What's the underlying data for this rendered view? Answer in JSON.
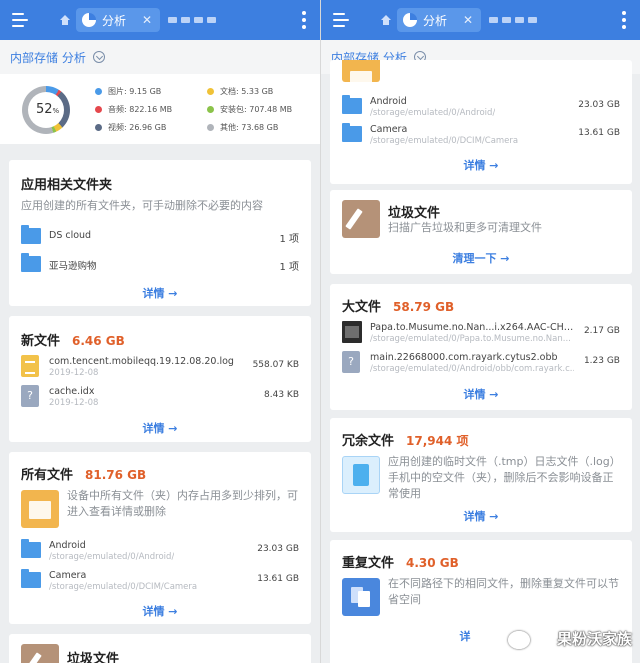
{
  "topbar": {
    "tab_label": "分析",
    "tab_close": "✕"
  },
  "subheader": {
    "title": "内部存储 分析"
  },
  "left": {
    "summary": {
      "percent": "52",
      "percent_unit": "%",
      "legend": [
        {
          "label": "图片: 9.15 GB",
          "color": "#4a9ae8"
        },
        {
          "label": "文档: 5.33 GB",
          "color": "#f0c237"
        },
        {
          "label": "音频: 822.16 MB",
          "color": "#e5484d"
        },
        {
          "label": "安装包: 707.48 MB",
          "color": "#8bc34a"
        },
        {
          "label": "视频: 26.96 GB",
          "color": "#5b6b86"
        },
        {
          "label": "其他: 73.68 GB",
          "color": "#b0b4ba"
        }
      ]
    },
    "app_folders": {
      "title": "应用相关文件夹",
      "desc": "应用创建的所有文件夹，可手动删除不必要的内容",
      "items": [
        {
          "name": "DS cloud",
          "count": "1 项"
        },
        {
          "name": "亚马逊购物",
          "count": "1 项"
        }
      ],
      "more": "详情 →"
    },
    "new_files": {
      "title": "新文件",
      "amount": "6.46 GB",
      "items": [
        {
          "name": "com.tencent.mobileqq.19.12.08.20.log",
          "date": "2019-12-08",
          "size": "558.07 KB"
        },
        {
          "name": "cache.idx",
          "date": "2019-12-08",
          "size": "8.43 KB"
        }
      ],
      "more": "详情 →"
    },
    "all_files": {
      "title": "所有文件",
      "amount": "81.76 GB",
      "desc": "设备中所有文件（夹）内存占用多到少排列，可进入查看详情或删除",
      "items": [
        {
          "name": "Android",
          "path": "/storage/emulated/0/Android/",
          "size": "23.03 GB"
        },
        {
          "name": "Camera",
          "path": "/storage/emulated/0/DCIM/Camera",
          "size": "13.61 GB"
        }
      ],
      "more": "详情 →"
    },
    "junk_peek": {
      "title": "垃圾文件"
    }
  },
  "right": {
    "all_files_tail": {
      "items": [
        {
          "name": "Android",
          "path": "/storage/emulated/0/Android/",
          "size": "23.03 GB"
        },
        {
          "name": "Camera",
          "path": "/storage/emulated/0/DCIM/Camera",
          "size": "13.61 GB"
        }
      ],
      "more": "详情 →"
    },
    "junk": {
      "title": "垃圾文件",
      "desc": "扫描广告垃圾和更多可清理文件",
      "action": "清理一下 →"
    },
    "large_files": {
      "title": "大文件",
      "amount": "58.79 GB",
      "items": [
        {
          "name": "Papa.to.Musume.no.Nan...i.x264.AAC-CHDTV.mkv",
          "path": "/storage/emulated/0/Papa.to.Musume.no.Nan...",
          "size": "2.17 GB"
        },
        {
          "name": "main.22668000.com.rayark.cytus2.obb",
          "path": "/storage/emulated/0/Android/obb/com.rayark.c...",
          "size": "1.23 GB"
        }
      ],
      "more": "详情 →"
    },
    "redundant": {
      "title": "冗余文件",
      "amount": "17,944 项",
      "desc": "应用创建的临时文件（.tmp）日志文件（.log）手机中的空文件（夹），删除后不会影响设备正常使用",
      "more": "详情 →"
    },
    "duplicate": {
      "title": "重复文件",
      "amount": "4.30 GB",
      "desc": "在不同路径下的相同文件，删除重复文件可以节省空间",
      "more": "详"
    },
    "watermark": "果粉沃家族"
  }
}
